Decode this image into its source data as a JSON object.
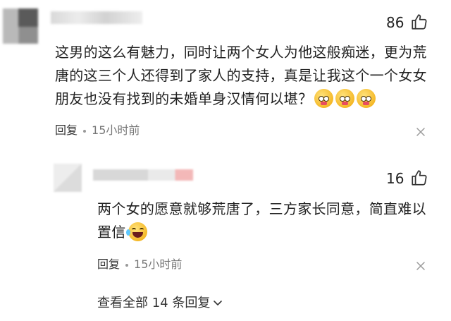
{
  "comment": {
    "likes": "86",
    "text": "这男的这么有魅力，同时让两个女人为他这般痴迷，更为荒唐的这三个人还得到了家人的支持，真是让我这个一个女女朋友也没有找到的未婚单身汉情何以堪？",
    "emojis": [
      "shy-emoji",
      "shy-emoji",
      "shy-emoji"
    ],
    "reply_label": "回复",
    "time": "15小时前"
  },
  "reply": {
    "likes": "16",
    "text": "两个女的愿意就够荒唐了，三方家长同意，简直难以置信",
    "emoji": "laugh-cry-emoji",
    "reply_label": "回复",
    "time": "15小时前"
  },
  "view_all": {
    "label": "查看全部 14 条回复"
  },
  "colors": {
    "text": "#222222",
    "meta": "#777777",
    "icon": "#333333"
  }
}
